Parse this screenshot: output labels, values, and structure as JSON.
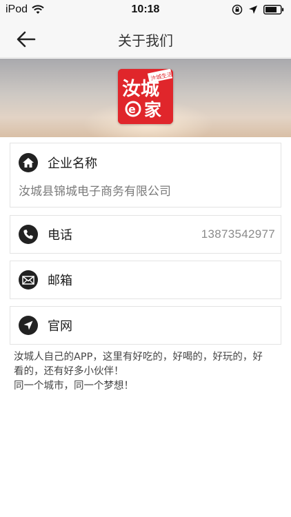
{
  "status_bar": {
    "carrier": "iPod",
    "time": "10:18",
    "icons": [
      "wifi-icon",
      "orientation-lock-icon",
      "location-arrow-icon",
      "battery-icon"
    ]
  },
  "nav": {
    "title": "关于我们",
    "back_icon": "arrow-left-icon"
  },
  "banner": {
    "logo_text": "汝城e家",
    "logo_tag": "汝城生活"
  },
  "company": {
    "label": "企业名称",
    "icon": "home-icon",
    "value": "汝城县锦城电子商务有限公司"
  },
  "phone": {
    "label": "电话",
    "icon": "phone-icon",
    "value": "13873542977"
  },
  "email": {
    "label": "邮箱",
    "icon": "mail-icon"
  },
  "website": {
    "label": "官网",
    "icon": "location-arrow-icon"
  },
  "slogan": {
    "line1": "汝城人自己的APP，这里有好吃的，好喝的，好玩的，好看的，还有好多小伙伴！",
    "line2": "同一个城市，同一个梦想！"
  },
  "colors": {
    "brand_red": "#e0262b",
    "icon_dark": "#222222",
    "nav_bg": "#f7f7f7"
  }
}
